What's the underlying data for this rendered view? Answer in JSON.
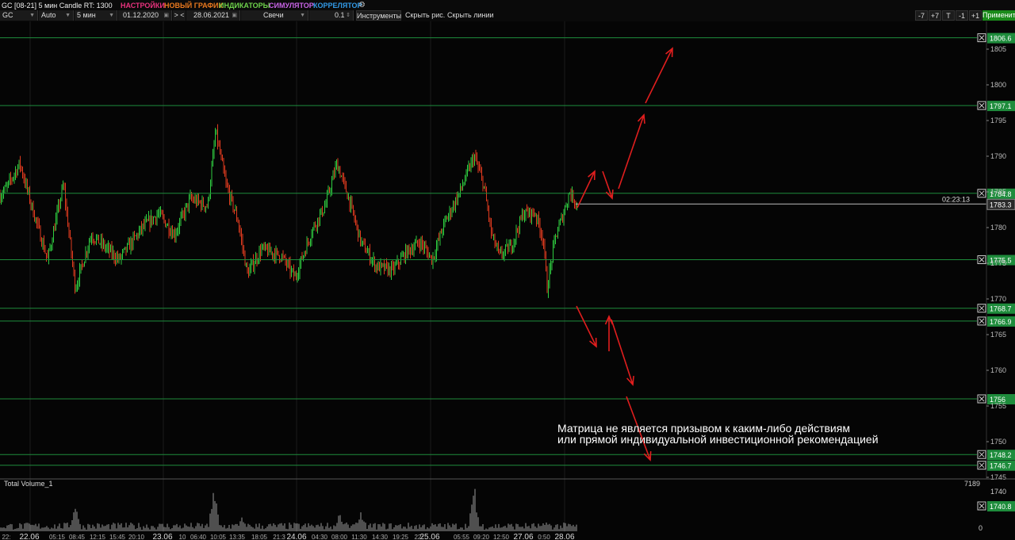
{
  "toolbar": {
    "title": "GC [08-21] 5 мин Candle RT: 1300",
    "menu": [
      {
        "label": "НАСТРОЙКИ",
        "color": "#e8327d"
      },
      {
        "label": "НОВЫЙ ГРАФИК",
        "color": "#e8781e"
      },
      {
        "label": "ИНДИКАТОРЫ",
        "color": "#6ed24b"
      },
      {
        "label": "СИМУЛЯТОР",
        "color": "#c864e6"
      },
      {
        "label": "КОРРЕЛЯТОР",
        "color": "#329be8"
      }
    ],
    "symbol": "GC",
    "mode": "Auto",
    "timeframe": "5 мин",
    "date_from": "01.12.2020",
    "date_to": "28.06.2021",
    "nav_label": "> <",
    "chart_type": "Свечи",
    "step": "0.1",
    "tools_button": "Инструменты",
    "hide_drawings": "Скрыть рис.",
    "hide_lines": "Скрыть линии",
    "shift_buttons": [
      "-7",
      "+7",
      "T",
      "-1",
      "+1"
    ],
    "apply_button": "Применить"
  },
  "price_scale": {
    "ticks": [
      "1805",
      "1800",
      "1795",
      "1790",
      "1785",
      "1780",
      "1775",
      "1770",
      "1765",
      "1760",
      "1755",
      "1750",
      "1745"
    ],
    "current_price": "1783.3",
    "countdown": "02:23:13"
  },
  "levels": [
    "1806.6",
    "1797.1",
    "1784.8",
    "1775.5",
    "1768.7",
    "1766.9",
    "1756",
    "1748.2",
    "1746.7"
  ],
  "disclaimer": [
    "Матрица не является призывом к каким-либо действиям",
    "или прямой индивидуальной инвестиционной рекомендацией"
  ],
  "volume_panel": {
    "title": "Total Volume_1",
    "max_label": "7189",
    "zero_label": "0",
    "price_tick": "1740",
    "level_label": "1740.8"
  },
  "time_axis": [
    {
      "label": "22:",
      "day": false
    },
    {
      "label": "22.06",
      "day": true
    },
    {
      "label": "05:15",
      "day": false
    },
    {
      "label": "08:45",
      "day": false
    },
    {
      "label": "12:15",
      "day": false
    },
    {
      "label": "15:45",
      "day": false
    },
    {
      "label": "20:10",
      "day": false
    },
    {
      "label": "23.06",
      "day": true
    },
    {
      "label": "10",
      "day": false
    },
    {
      "label": "06:40",
      "day": false
    },
    {
      "label": "10:05",
      "day": false
    },
    {
      "label": "13:35",
      "day": false
    },
    {
      "label": "18:05",
      "day": false
    },
    {
      "label": "21:3",
      "day": false
    },
    {
      "label": "24.06",
      "day": true
    },
    {
      "label": "04:30",
      "day": false
    },
    {
      "label": "08:00",
      "day": false
    },
    {
      "label": "11:30",
      "day": false
    },
    {
      "label": "14:30",
      "day": false
    },
    {
      "label": "19:25",
      "day": false
    },
    {
      "label": "22:",
      "day": false
    },
    {
      "label": "25.06",
      "day": true
    },
    {
      "label": "05:55",
      "day": false
    },
    {
      "label": "09:20",
      "day": false
    },
    {
      "label": "12:50",
      "day": false
    },
    {
      "label": "27.06",
      "day": true
    },
    {
      "label": "0:50",
      "day": false
    },
    {
      "label": "28.06",
      "day": true
    }
  ],
  "colors": {
    "background": "#000000",
    "level_line": "#1e8c3c",
    "level_tag": "#1e8c3c",
    "arrow": "#e01e1e",
    "candle_up": "#2ecc40",
    "candle_down": "#e03a1e"
  }
}
